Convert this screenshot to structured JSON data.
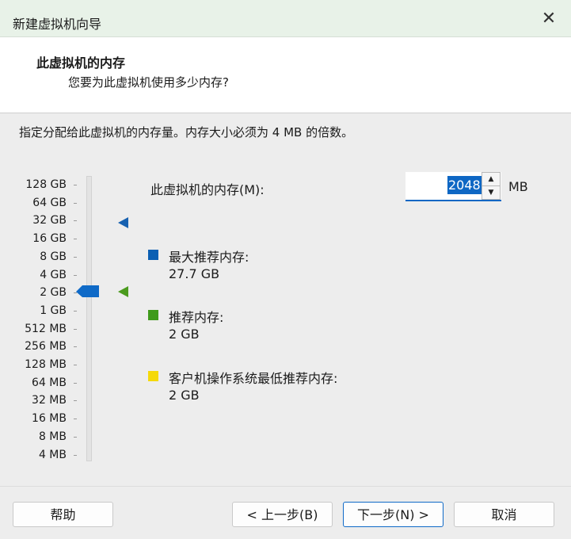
{
  "window": {
    "title": "新建虚拟机向导",
    "close_icon": "close-icon"
  },
  "header": {
    "title": "此虚拟机的内存",
    "subtitle": "您要为此虚拟机使用多少内存?"
  },
  "description": "指定分配给此虚拟机的内存量。内存大小必须为 4 MB 的倍数。",
  "scale": {
    "labels": [
      "128 GB",
      "64 GB",
      "32 GB",
      "16 GB",
      "8 GB",
      "4 GB",
      "2 GB",
      "1 GB",
      "512 MB",
      "256 MB",
      "128 MB",
      "64 MB",
      "32 MB",
      "16 MB",
      "8 MB",
      "4 MB"
    ],
    "selected": "2 GB"
  },
  "memory": {
    "label": "此虚拟机的内存(M):",
    "value": "2048",
    "unit": "MB"
  },
  "legend": [
    {
      "title": "最大推荐内存:",
      "value": "27.7 GB",
      "color": "#0b5fb3"
    },
    {
      "title": "推荐内存:",
      "value": "2 GB",
      "color": "#3f9a1b"
    },
    {
      "title": "客户机操作系统最低推荐内存:",
      "value": "2 GB",
      "color": "#f5d90a"
    }
  ],
  "buttons": {
    "help": "帮助",
    "back": "< 上一步(B)",
    "next": "下一步(N) >",
    "cancel": "取消"
  }
}
